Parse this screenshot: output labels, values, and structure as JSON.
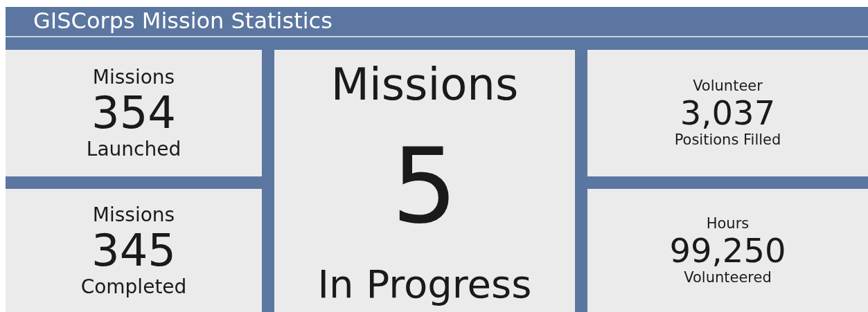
{
  "header": {
    "title": "GISCorps Mission Statistics"
  },
  "tiles": [
    {
      "kind": "standard",
      "top": "Missions",
      "value": "354",
      "bottom": "Launched"
    },
    {
      "kind": "featured",
      "top": "Missions",
      "value": "5",
      "bottom": "In Progress"
    },
    {
      "kind": "compact",
      "top": "Volunteer",
      "value": "3,037",
      "bottom": "Positions Filled"
    },
    {
      "kind": "standard",
      "top": "Missions",
      "value": "345",
      "bottom": "Completed"
    },
    {
      "kind": "compact",
      "top": "Hours",
      "value": "99,250",
      "bottom": "Volunteered"
    }
  ]
}
